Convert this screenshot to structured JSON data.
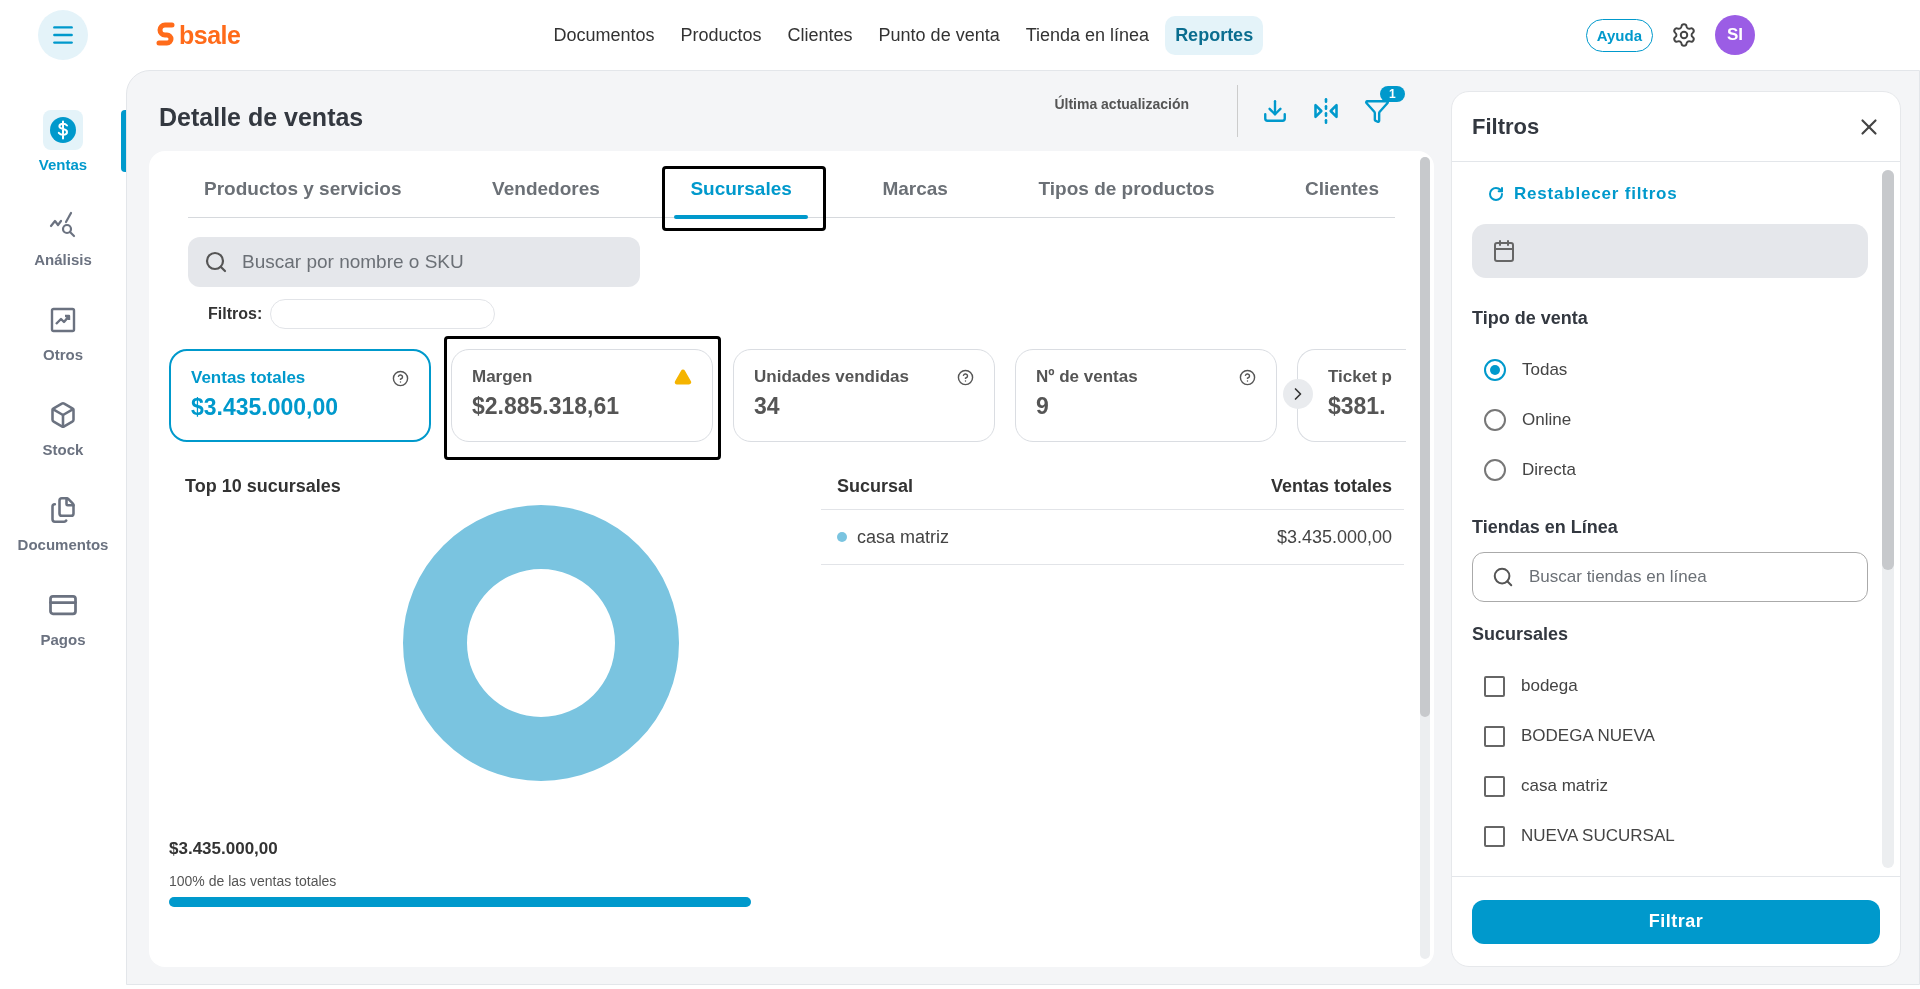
{
  "topbar": {
    "logo": "bsale",
    "nav": [
      {
        "label": "Documentos",
        "selected": false
      },
      {
        "label": "Productos",
        "selected": false
      },
      {
        "label": "Clientes",
        "selected": false
      },
      {
        "label": "Punto de venta",
        "selected": false
      },
      {
        "label": "Tienda en línea",
        "selected": false
      },
      {
        "label": "Reportes",
        "selected": true
      }
    ],
    "help": "Ayuda",
    "avatar": "SI"
  },
  "sidebar": {
    "items": [
      {
        "kind": "sales",
        "label": "Ventas",
        "selected": true
      },
      {
        "kind": "analysis",
        "label": "Análisis",
        "selected": false
      },
      {
        "kind": "other",
        "label": "Otros",
        "selected": false
      },
      {
        "kind": "stock",
        "label": "Stock",
        "selected": false
      },
      {
        "kind": "documents",
        "label": "Documentos",
        "selected": false
      },
      {
        "kind": "payments",
        "label": "Pagos",
        "selected": false
      }
    ]
  },
  "page": {
    "title": "Detalle de ventas",
    "last_update": "Última actualización",
    "filter_count": "1"
  },
  "tabs": [
    {
      "label": "Productos y servicios",
      "selected": false,
      "outlined": false
    },
    {
      "label": "Vendedores",
      "selected": false,
      "outlined": false
    },
    {
      "label": "Sucursales",
      "selected": true,
      "outlined": true
    },
    {
      "label": "Marcas",
      "selected": false,
      "outlined": false
    },
    {
      "label": "Tipos de productos",
      "selected": false,
      "outlined": false
    },
    {
      "label": "Clientes",
      "selected": false,
      "outlined": false
    }
  ],
  "search": {
    "placeholder": "Buscar por nombre o SKU"
  },
  "filters_label": "Filtros:",
  "kpis": [
    {
      "title": "Ventas totales",
      "value": "$3.435.000,00",
      "kind": "help",
      "selected": true,
      "outlined": false
    },
    {
      "title": "Margen",
      "value": "$2.885.318,61",
      "kind": "warning",
      "selected": false,
      "outlined": true
    },
    {
      "title": "Unidades vendidas",
      "value": "34",
      "kind": "help",
      "selected": false,
      "outlined": false
    },
    {
      "title": "Nº de ventas",
      "value": "9",
      "kind": "help",
      "selected": false,
      "outlined": false
    },
    {
      "title": "Ticket p",
      "value": "$381.",
      "kind": "cut",
      "selected": false,
      "outlined": false
    }
  ],
  "top": {
    "title": "Top 10 sucursales",
    "total": "$3.435.000,00",
    "share_label": "100% de las ventas totales",
    "level": 1
  },
  "table": {
    "columns": [
      "Sucursal",
      "Ventas totales"
    ],
    "rows": [
      {
        "name": "casa matriz",
        "value": "$3.435.000,00",
        "color": "#7ac4e0"
      }
    ]
  },
  "filters": {
    "title": "Filtros",
    "reset": "Restablecer filtros",
    "sale_type": {
      "title": "Tipo de venta",
      "options": [
        {
          "label": "Todas",
          "selected": true
        },
        {
          "label": "Online",
          "selected": false
        },
        {
          "label": "Directa",
          "selected": false
        }
      ]
    },
    "online_stores": {
      "title": "Tiendas en Línea",
      "placeholder": "Buscar tiendas en línea"
    },
    "branches": {
      "title": "Sucursales",
      "options": [
        {
          "label": "bodega",
          "checked": false
        },
        {
          "label": "BODEGA NUEVA",
          "checked": false
        },
        {
          "label": "casa matriz",
          "checked": false
        },
        {
          "label": "NUEVA SUCURSAL",
          "checked": false
        }
      ]
    },
    "submit": "Filtrar"
  }
}
